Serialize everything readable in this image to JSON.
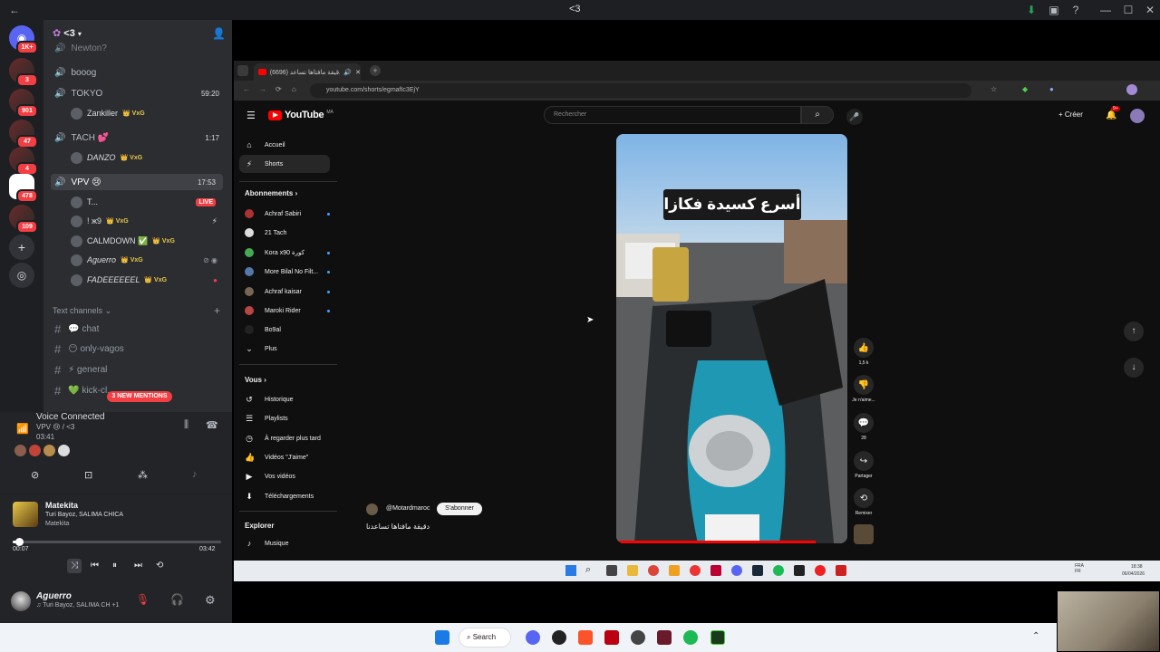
{
  "window": {
    "title": "<3"
  },
  "discord": {
    "servers": [
      {
        "badge": "1K+"
      },
      {
        "badge": "3"
      },
      {
        "badge": "901"
      },
      {
        "badge": "47"
      },
      {
        "badge": "4"
      },
      {
        "badge": "478"
      },
      {
        "badge": "109"
      }
    ],
    "server_name": "<3",
    "voice_channels": [
      {
        "name": "Newton?"
      },
      {
        "name": "booog"
      },
      {
        "name": "TOKYO",
        "time": "59:20"
      },
      {
        "name": "TACH 💕",
        "time": "1:17"
      },
      {
        "name": "VPV 😢",
        "time": "17:53"
      }
    ],
    "users": {
      "tokyo": [
        {
          "name": "Zankiller",
          "tag": "👑 VxG"
        }
      ],
      "tach": [
        {
          "name": "DANZO",
          "tag": "👑 VxG"
        }
      ],
      "vpv": [
        {
          "name": "T...",
          "tag": "",
          "live": "LIVE"
        },
        {
          "name": "! ж9",
          "tag": "👑 VxG"
        },
        {
          "name": "CALMDOWN ✅",
          "tag": "👑 VxG"
        },
        {
          "name": "Aguerro",
          "tag": "👑 VxG"
        },
        {
          "name": "FADEEEEEEL",
          "tag": "👑 VxG"
        }
      ]
    },
    "text_channels_header": "Text channels",
    "text_channels": [
      {
        "name": "💬 chat"
      },
      {
        "name": "😶 only-vagos"
      },
      {
        "name": "⚡ general"
      },
      {
        "name": "💚 kick-cl..."
      }
    ],
    "mentions_badge": "3 NEW MENTIONS",
    "voice": {
      "status": "Voice Connected",
      "channel": "VPV 😢 / <3",
      "timer": "03:41"
    },
    "music": {
      "title": "Matekita",
      "artists": "Turi Bayoz, SALIMA CHICA",
      "album": "Matekita",
      "elapsed": "00:07",
      "duration": "03:42",
      "progress": 0.032
    },
    "user": {
      "name": "Aguerro",
      "status": "♫ Turi Bayoz, SALIMA CH +1"
    }
  },
  "browser": {
    "tab_title": "دقيقة مافتاها تساعد (6696)",
    "url": "youtube.com/shorts/egmafIc3EjY",
    "youtube": {
      "logo": "YouTube",
      "region": "MA",
      "search_placeholder": "Rechercher",
      "create_label": "Créer",
      "notif_count": "9+",
      "nav": [
        {
          "label": "Accueil",
          "icon": "home-icon"
        },
        {
          "label": "Shorts",
          "icon": "shorts-icon"
        }
      ],
      "subscriptions_header": "Abonnements",
      "subscriptions": [
        {
          "name": "Achraf Sabiri"
        },
        {
          "name": "21 Tach"
        },
        {
          "name": "Kora x90 كورة"
        },
        {
          "name": "More Bilal No Filt..."
        },
        {
          "name": "Achraf kaisar"
        },
        {
          "name": "Maroki Rider"
        },
        {
          "name": "Bo9al"
        },
        {
          "name": "Plus"
        }
      ],
      "you_header": "Vous",
      "you_items": [
        {
          "label": "Historique"
        },
        {
          "label": "Playlists"
        },
        {
          "label": "À regarder plus tard"
        },
        {
          "label": "Vidéos \"J'aime\""
        },
        {
          "label": "Vos vidéos"
        },
        {
          "label": "Téléchargements"
        }
      ],
      "explore_header": "Explorer",
      "explore_items": [
        {
          "label": "Musique"
        }
      ],
      "short": {
        "overlay_text": "أسرع كسيدة فكازا",
        "channel": "@Motardmaroc",
        "subscribe": "S'abonner",
        "title": "دقيقة مافتاها تساعدنا",
        "actions": [
          {
            "icon": "like-icon",
            "label": "1,5 k"
          },
          {
            "icon": "dislike-icon",
            "label": "Je n'aime..."
          },
          {
            "icon": "comment-icon",
            "label": "28"
          },
          {
            "icon": "share-icon",
            "label": "Partager"
          },
          {
            "icon": "remix-icon",
            "label": "Remixer"
          }
        ]
      }
    },
    "inner_clock": {
      "time": "18:38",
      "date": "06/04/2026",
      "lang": "FRA FR"
    }
  },
  "taskbar": {
    "search_label": "Search"
  },
  "colors": {
    "discord_bg": "#2b2d31",
    "youtube_red": "#ff0000",
    "accent": "#5865f2"
  }
}
